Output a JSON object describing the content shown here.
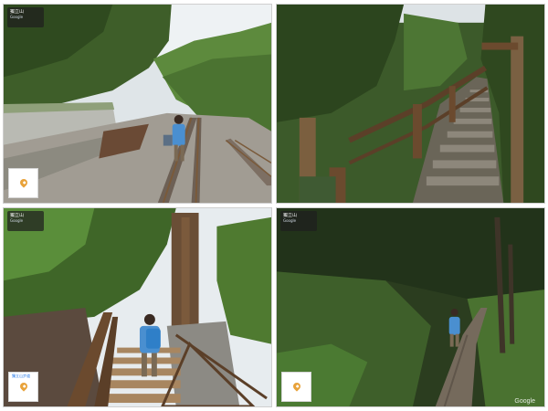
{
  "panels": [
    {
      "id": "railway",
      "info_line1": "獨立山",
      "info_line2": "Google",
      "thumb_label": ""
    },
    {
      "id": "stone-stairs",
      "info_line1": "",
      "info_line2": "",
      "thumb_label": ""
    },
    {
      "id": "wooden-stairs",
      "info_line1": "獨立山",
      "info_line2": "Google",
      "thumb_label": "獨立山步道"
    },
    {
      "id": "forest-trail",
      "info_line1": "獨立山",
      "info_line2": "Google",
      "thumb_label": ""
    }
  ],
  "watermark": "Google",
  "colors": {
    "sky": "#e9eef2",
    "foliage_dark": "#2f4a22",
    "foliage_mid": "#4f7a34",
    "rail": "#7a5a3a",
    "gravel": "#9a958c",
    "shirt_blue": "#4a8fd0",
    "wood": "#6b4a2e"
  },
  "icons": {
    "thumbnail_marker": "map-pin-icon"
  }
}
